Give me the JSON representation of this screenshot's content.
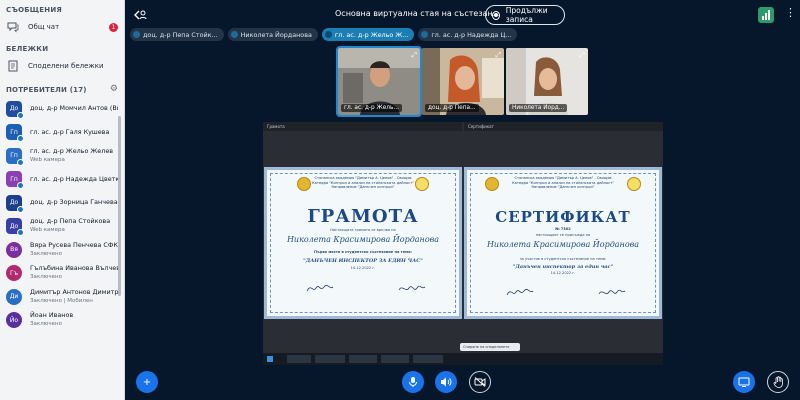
{
  "sidebar": {
    "messages_title": "СЪОБЩЕНИЯ",
    "public_chat": {
      "label": "Общ чат",
      "unread": "1"
    },
    "notes_title": "БЕЛЕЖКИ",
    "shared_notes": "Споделени бележки",
    "users_title": "ПОТРЕБИТЕЛИ (17)",
    "users": [
      {
        "initials": "До",
        "name": "доц. д-р Момчил Антов (Вие)",
        "status": "",
        "color": "#1f4e9e",
        "round": false
      },
      {
        "initials": "Гп",
        "name": "гл. ас. д-р Галя Кушева",
        "status": "",
        "color": "#1d5fb3",
        "round": false
      },
      {
        "initials": "Гп",
        "name": "гл. ас. д-р Жельо Желев",
        "status": "Web камера",
        "color": "#2b6fc4",
        "round": false
      },
      {
        "initials": "Гп",
        "name": "гл. ас. д-р Надежда Цветкова",
        "status": "",
        "color": "#8a3fb3",
        "round": false
      },
      {
        "initials": "До",
        "name": "доц. д-р Зорница Ганчева",
        "status": "",
        "color": "#1c3f8c",
        "round": false
      },
      {
        "initials": "До",
        "name": "доц. д-р Пепа Стойкова",
        "status": "Web камера",
        "color": "#3a3fa8",
        "round": false
      },
      {
        "initials": "Вя",
        "name": "Вяра Русева Пенчева СФК",
        "status": "Заключено",
        "color": "#7a2f9e",
        "round": true
      },
      {
        "initials": "Гъ",
        "name": "Гълъбина Иванова Вълчева ...",
        "status": "Заключено",
        "color": "#b02a6e",
        "round": true
      },
      {
        "initials": "Ди",
        "name": "Димитър Антонов Димитров ...",
        "status": "Заключено | Мобилен",
        "color": "#2b6fc4",
        "round": true
      },
      {
        "initials": "Йо",
        "name": "Йоан Иванов",
        "status": "Заключено",
        "color": "#5b2f9e",
        "round": true
      }
    ]
  },
  "topbar": {
    "title": "Основна виртуална стая на състезан...",
    "record_label": "Продължи записа"
  },
  "chips": [
    {
      "label": "доц. д-р Пепа Стойк...",
      "active": false
    },
    {
      "label": "Николета Йорданова",
      "active": false
    },
    {
      "label": "гл. ас. д-р Жельо Ж...",
      "active": true
    },
    {
      "label": "гл. ас. д-р Надежда Ц...",
      "active": false
    }
  ],
  "tiles": [
    {
      "label": "гл. ас. д-р Жель...",
      "speaking": true
    },
    {
      "label": "доц. д-р Пепа...",
      "speaking": false
    },
    {
      "label": "Николета Йорд...",
      "speaking": false
    }
  ],
  "screen": {
    "left_window": "Грамота",
    "right_window": "Сертификат",
    "left_cert": {
      "header": "Стопанска академия \"Димитър А. Ценов\" - Свищов",
      "subheader": "Катедра \"Контрол и анализ на стопанската дейност\"",
      "program": "Направление \"Данъчен контрол\"",
      "title": "ГРАМОТА",
      "awarded_to": "Настоящата грамота се връчва на",
      "name": "Николета Красимирова Йорданова",
      "achievement": "Първо място в студентско състезание на тема:",
      "topic": "\"ДАНЪЧЕН ИНСПЕКТОР ЗА ЕДИН ЧАС\"",
      "date": "14.12.2022 г."
    },
    "right_cert": {
      "header": "Стопанска академия \"Димитър А. Ценов\" - Свищов",
      "subheader": "Катедра \"Контрол и анализ на стопанската дейност\"",
      "program": "Направление \"Данъчен контрол\"",
      "title": "СЕРТИФИКАТ",
      "number": "№ 7302",
      "awarded_to": "настоящият се присъжда на",
      "name": "Николета Красимирова Йорданова",
      "participation": "за участие в студентско състезание на тема:",
      "topic": "\"Данъчен инспектор за един час\"",
      "date": "14.12.2022 г."
    },
    "share_popup": "Спиране на споделянето"
  },
  "colors": {
    "accent": "#1a73e8",
    "background": "#06172b",
    "alert": "#d7263d"
  }
}
